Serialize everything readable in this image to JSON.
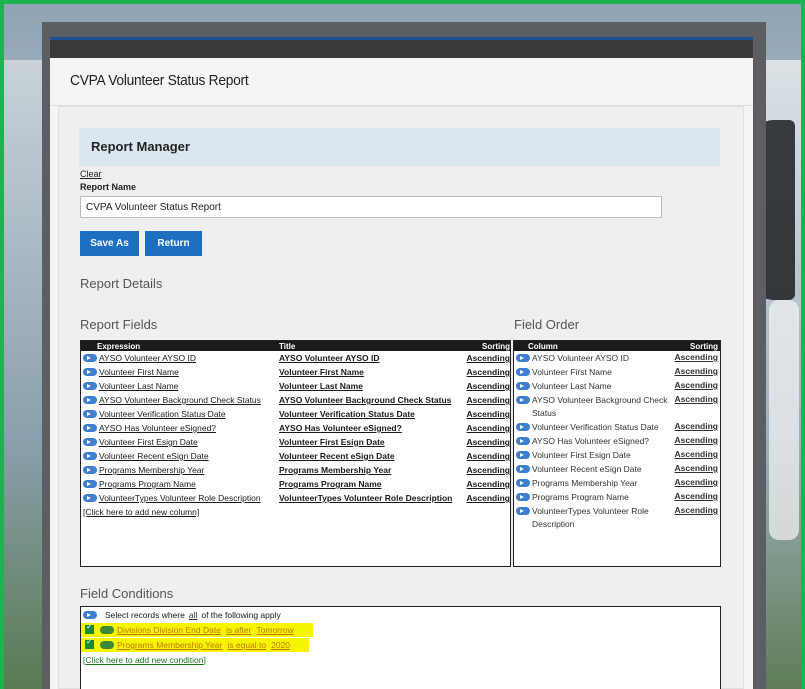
{
  "page": {
    "title": "CVPA Volunteer Status Report"
  },
  "report_manager": {
    "heading": "Report Manager",
    "clear_label": "Clear",
    "report_name_label": "Report Name",
    "report_name_value": "CVPA Volunteer Status Report",
    "save_as_label": "Save As",
    "return_label": "Return"
  },
  "sections": {
    "report_details": "Report Details",
    "report_fields": "Report Fields",
    "field_order": "Field Order",
    "field_conditions": "Field Conditions"
  },
  "report_fields": {
    "headers": {
      "expression": "Expression",
      "title": "Title",
      "sorting": "Sorting"
    },
    "rows": [
      {
        "expression": "AYSO Volunteer AYSO ID",
        "title": "AYSO Volunteer AYSO ID",
        "sorting": "Ascending"
      },
      {
        "expression": "Volunteer First Name",
        "title": "Volunteer First Name",
        "sorting": "Ascending"
      },
      {
        "expression": "Volunteer Last Name",
        "title": "Volunteer Last Name",
        "sorting": "Ascending"
      },
      {
        "expression": "AYSO Volunteer Background Check Status",
        "title": "AYSO Volunteer Background Check Status",
        "sorting": "Ascending"
      },
      {
        "expression": "Volunteer Verification Status Date",
        "title": "Volunteer Verification Status Date",
        "sorting": "Ascending"
      },
      {
        "expression": "AYSO Has Volunteer eSigned?",
        "title": "AYSO Has Volunteer eSigned?",
        "sorting": "Ascending"
      },
      {
        "expression": "Volunteer First Esign Date",
        "title": "Volunteer First Esign Date",
        "sorting": "Ascending"
      },
      {
        "expression": "Volunteer Recent eSign Date",
        "title": "Volunteer Recent eSign Date",
        "sorting": "Ascending"
      },
      {
        "expression": "Programs Membership Year",
        "title": "Programs Membership Year",
        "sorting": "Ascending"
      },
      {
        "expression": "Programs Program Name",
        "title": "Programs Program Name",
        "sorting": "Ascending"
      },
      {
        "expression": "VolunteerTypes Volunteer Role Description",
        "title": "VolunteerTypes Volunteer Role Description",
        "sorting": "Ascending"
      }
    ],
    "add_column_label": "[Click here to add new column]"
  },
  "field_order": {
    "headers": {
      "column": "Column",
      "sorting": "Sorting"
    },
    "rows": [
      {
        "column": "AYSO Volunteer AYSO ID",
        "sorting": "Ascending"
      },
      {
        "column": "Volunteer First Name",
        "sorting": "Ascending"
      },
      {
        "column": "Volunteer Last Name",
        "sorting": "Ascending"
      },
      {
        "column": "AYSO Volunteer Background Check Status",
        "sorting": "Ascending"
      },
      {
        "column": "Volunteer Verification Status Date",
        "sorting": "Ascending"
      },
      {
        "column": "AYSO Has Volunteer eSigned?",
        "sorting": "Ascending"
      },
      {
        "column": "Volunteer First Esign Date",
        "sorting": "Ascending"
      },
      {
        "column": "Volunteer Recent eSign Date",
        "sorting": "Ascending"
      },
      {
        "column": "Programs Membership Year",
        "sorting": "Ascending"
      },
      {
        "column": "Programs Program Name",
        "sorting": "Ascending"
      },
      {
        "column": "VolunteerTypes Volunteer Role Description",
        "sorting": "Ascending"
      }
    ]
  },
  "field_conditions": {
    "intro_prefix": "Select records where",
    "intro_mode": "all",
    "intro_suffix": "of the following apply",
    "conditions": [
      {
        "field": "Divisions Division End Date",
        "operator": "is after",
        "value": "Tomorrow"
      },
      {
        "field": "Programs Membership Year",
        "operator": "is equal to",
        "value": "2020"
      }
    ],
    "add_condition_label": "[Click here to add new condition]"
  },
  "colors": {
    "accent": "#1d6fbf",
    "frame": "#1db34f",
    "highlight": "#f7f400",
    "header_bg": "#dbe7ef"
  },
  "icons": [
    "expand-pill-icon",
    "checkbox-icon",
    "condition-pill-icon"
  ]
}
